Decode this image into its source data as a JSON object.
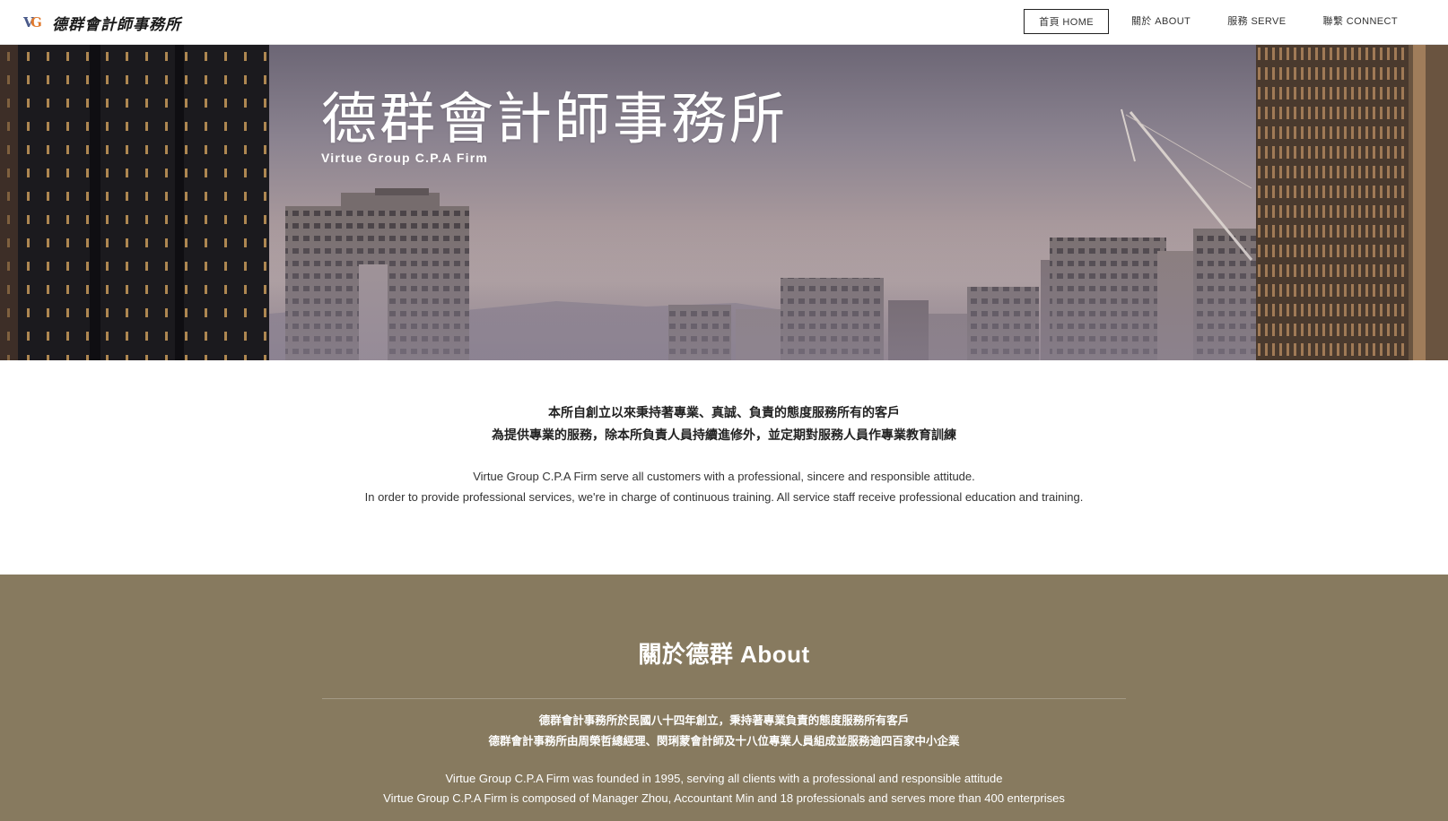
{
  "header": {
    "logo_mark_v": "V",
    "logo_mark_g": "G",
    "logo_text": "德群會計師事務所",
    "nav": [
      {
        "label": "首頁 HOME",
        "active": true
      },
      {
        "label": "關於 ABOUT",
        "active": false
      },
      {
        "label": "服務 SERVE",
        "active": false
      },
      {
        "label": "聯繫 CONNECT",
        "active": false
      }
    ]
  },
  "hero": {
    "title": "德群會計師事務所",
    "subtitle": "Virtue Group C.P.A Firm"
  },
  "intro": {
    "zh_line1": "本所自創立以來秉持著專業、真誠、負責的態度服務所有的客戶",
    "zh_line2": "為提供專業的服務，除本所負責人員持續進修外，並定期對服務人員作專業教育訓練",
    "en_line1": "Virtue Group C.P.A Firm serve all customers with a professional, sincere and responsible attitude.",
    "en_line2": "In order to provide professional services, we're in charge of continuous training. All service staff receive professional education and training."
  },
  "about": {
    "title": "關於德群 About",
    "zh_line1": "德群會計事務所於民國八十四年創立，秉持著專業負責的態度服務所有客戶",
    "zh_line2": "德群會計事務所由周榮哲總經理、閔琍蒙會計師及十八位專業人員組成並服務逾四百家中小企業",
    "en_line1": "Virtue Group C.P.A Firm was founded in 1995, serving all clients with a professional and responsible attitude",
    "en_line2": "Virtue Group C.P.A Firm is composed of Manager Zhou, Accountant Min and 18 professionals and serves more than 400 enterprises"
  },
  "colors": {
    "about_background": "#877a5f",
    "hero_sky": "#a6979b"
  }
}
